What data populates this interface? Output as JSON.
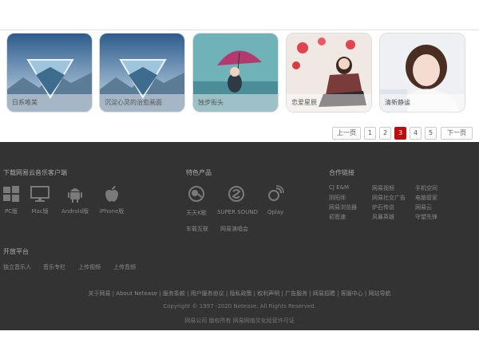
{
  "cards": [
    {
      "caption": "日系唯美",
      "image": "mountain-triangle"
    },
    {
      "caption": "沉淀心灵的治愈画面",
      "image": "mountain-triangle"
    },
    {
      "caption": "独步街头",
      "image": "umbrella-girl"
    },
    {
      "caption": "恋爱星辰",
      "image": "balloon-girl"
    },
    {
      "caption": "清新静谧",
      "image": "portrait-girl"
    }
  ],
  "pager": {
    "prev": "上一页",
    "pages": [
      "1",
      "2",
      "3",
      "4",
      "5"
    ],
    "active": "3",
    "next": "下一页"
  },
  "footer": {
    "download_title": "下载网易云音乐客户端",
    "platforms": [
      {
        "label": "PC版",
        "icon": "windows-icon"
      },
      {
        "label": "Mac版",
        "icon": "monitor-icon"
      },
      {
        "label": "Android版",
        "icon": "android-icon"
      },
      {
        "label": "iPhone版",
        "icon": "apple-icon"
      }
    ],
    "products_title": "特色产品",
    "products": [
      {
        "label": "天天K歌",
        "icon": "karaoke-icon"
      },
      {
        "label": "SUPER SOUND",
        "icon": "supersound-icon"
      },
      {
        "label": "Qplay",
        "icon": "qplay-icon"
      }
    ],
    "products_extra": [
      "车载互联",
      "网易演唱会"
    ],
    "partners_title": "合作链接",
    "partners": [
      [
        "CJ E&M",
        "网易视频",
        "手机空间"
      ],
      [
        "阴阳师",
        "网易社交广告",
        "电脑管家"
      ],
      [
        "网易浏览器",
        "炉石传说",
        "网易云"
      ],
      [
        "初音速",
        "风暴英雄",
        "守望先锋"
      ]
    ],
    "open_title": "开放平台",
    "open_links": [
      "独立音乐人",
      "音乐专栏",
      "上传视频",
      "上传音频"
    ],
    "bottom_links": "关于网易 | About Netease | 服务条款 | 用户服务协议 | 隐私政策 | 权利声明 | 广告服务 | 网易招聘 | 客服中心 | 网站导航",
    "copyright": "Copyright © 1997 -2020 Netease. All Rights Reserved.",
    "icp": "网易公司 版权所有 网易网络文化经营许可证"
  }
}
